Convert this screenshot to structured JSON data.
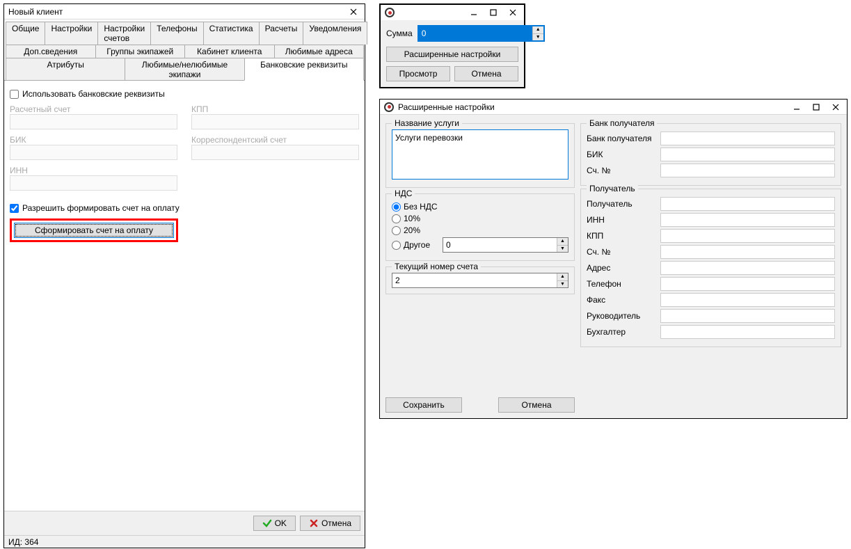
{
  "win1": {
    "title": "Новый клиент",
    "tabs_row1": [
      "Общие",
      "Настройки",
      "Настройки счетов",
      "Телефоны",
      "Статистика",
      "Расчеты",
      "Уведомления"
    ],
    "tabs_row2": [
      "Доп.сведения",
      "Группы экипажей",
      "Кабинет клиента",
      "Любимые адреса"
    ],
    "tabs_row3": [
      "Атрибуты",
      "Любимые/нелюбимые экипажи",
      "Банковские реквизиты"
    ],
    "active_tab": "Банковские реквизиты",
    "use_bank": "Использовать банковские реквизиты",
    "use_bank_checked": false,
    "labels": {
      "acct": "Расчетный счет",
      "kpp": "КПП",
      "bik": "БИК",
      "corr": "Корреспондентский счет",
      "inn": "ИНН"
    },
    "allow_invoice": "Разрешить формировать счет на оплату",
    "allow_invoice_checked": true,
    "form_invoice_btn": "Сформировать счет на оплату",
    "ok": "OK",
    "cancel": "Отмена",
    "status": "ИД: 364"
  },
  "win2": {
    "sum_label": "Сумма",
    "sum_value": "0",
    "btn_ext": "Расширенные настройки",
    "btn_preview": "Просмотр",
    "btn_cancel": "Отмена"
  },
  "win3": {
    "title": "Расширенные настройки",
    "svc_legend": "Название услуги",
    "svc_value": "Услуги перевозки",
    "nds_legend": "НДС",
    "nds_opts": {
      "none": "Без НДС",
      "p10": "10%",
      "p20": "20%",
      "other": "Другое"
    },
    "nds_other_val": "0",
    "cur_num_legend": "Текущий номер счета",
    "cur_num_val": "2",
    "btn_save": "Сохранить",
    "btn_cancel": "Отмена",
    "bank_legend": "Банк получателя",
    "bank_lbls": {
      "bank": "Банк получателя",
      "bik": "БИК",
      "acct": "Сч. №"
    },
    "recv_legend": "Получатель",
    "recv_lbls": {
      "recv": "Получатель",
      "inn": "ИНН",
      "kpp": "КПП",
      "acct": "Сч. №",
      "addr": "Адрес",
      "phone": "Телефон",
      "fax": "Факс",
      "head": "Руководитель",
      "bookkeeper": "Бухгалтер"
    }
  }
}
